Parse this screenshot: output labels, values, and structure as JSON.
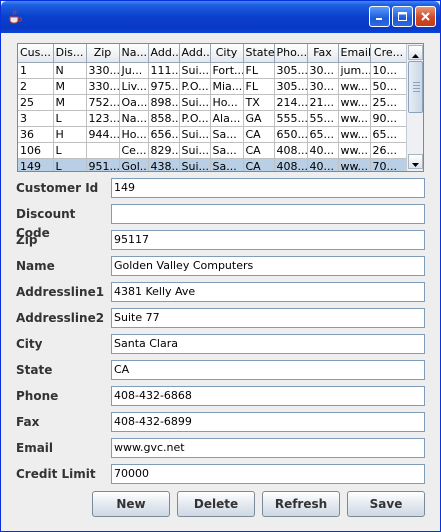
{
  "window": {
    "app_icon": "java-cup-icon",
    "controls": {
      "minimize": "minimize-icon",
      "maximize": "maximize-icon",
      "close": "close-icon"
    }
  },
  "table": {
    "columns": [
      "Cus...",
      "Dis...",
      "Zip",
      "Na...",
      "Add...",
      "Add...",
      "City",
      "State",
      "Pho...",
      "Fax",
      "Email",
      "Cre..."
    ],
    "rows": [
      [
        "1",
        "N",
        "330...",
        "Ju...",
        "111...",
        "Sui...",
        "Fort...",
        "FL",
        "305...",
        "30...",
        "jum...",
        "10..."
      ],
      [
        "2",
        "M",
        "330...",
        "Liv...",
        "975...",
        "P.O...",
        "Mia...",
        "FL",
        "305...",
        "30...",
        "ww...",
        "50..."
      ],
      [
        "25",
        "M",
        "752...",
        "Oa...",
        "898...",
        "Sui...",
        "Ho...",
        "TX",
        "214...",
        "21...",
        "ww...",
        "25..."
      ],
      [
        "3",
        "L",
        "123...",
        "Na...",
        "858...",
        "P.O...",
        "Ala...",
        "GA",
        "555...",
        "55...",
        "ww...",
        "90..."
      ],
      [
        "36",
        "H",
        "944...",
        "Ho...",
        "656...",
        "Sui...",
        "Sa...",
        "CA",
        "650...",
        "65...",
        "ww...",
        "65..."
      ],
      [
        "106",
        "L",
        "",
        "Ce...",
        "829...",
        "Sui...",
        "Sa...",
        "CA",
        "408...",
        "40...",
        "ww...",
        "26..."
      ],
      [
        "149",
        "L",
        "951...",
        "Gol...",
        "438...",
        "Sui...",
        "Sa...",
        "CA",
        "408...",
        "40...",
        "ww...",
        "70..."
      ]
    ],
    "selected_row": 6
  },
  "form": {
    "fields": [
      {
        "label": "Customer Id",
        "value": "149"
      },
      {
        "label": "Discount Code",
        "value": ""
      },
      {
        "label": "Zip",
        "value": "95117"
      },
      {
        "label": "Name",
        "value": "Golden Valley Computers"
      },
      {
        "label": "Addressline1",
        "value": "4381 Kelly Ave"
      },
      {
        "label": "Addressline2",
        "value": "Suite 77"
      },
      {
        "label": "City",
        "value": "Santa Clara"
      },
      {
        "label": "State",
        "value": "CA"
      },
      {
        "label": "Phone",
        "value": "408-432-6868"
      },
      {
        "label": "Fax",
        "value": "408-432-6899"
      },
      {
        "label": "Email",
        "value": "www.gvc.net"
      },
      {
        "label": "Credit Limit",
        "value": "70000"
      }
    ]
  },
  "buttons": {
    "new_label": "New",
    "delete_label": "Delete",
    "refresh_label": "Refresh",
    "save_label": "Save"
  }
}
